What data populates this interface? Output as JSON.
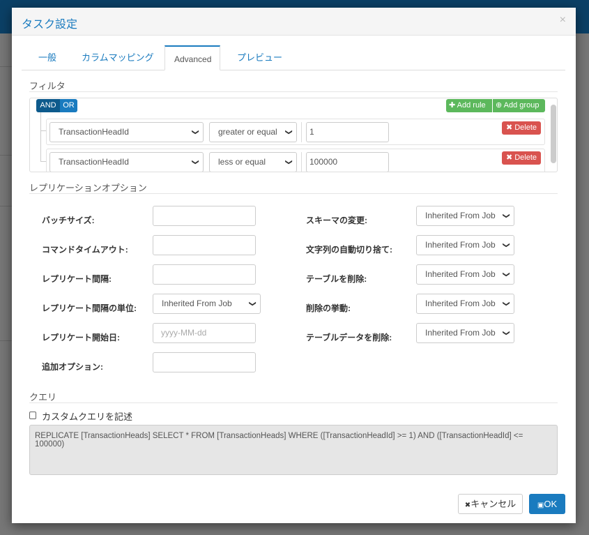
{
  "modal": {
    "title": "タスク設定",
    "close": "×"
  },
  "tabs": [
    {
      "label": "一般"
    },
    {
      "label": "カラムマッピング"
    },
    {
      "label": "Advanced"
    },
    {
      "label": "プレビュー"
    }
  ],
  "filter": {
    "section_title": "フィルタ",
    "and_label": "AND",
    "or_label": "OR",
    "add_rule": "Add rule",
    "add_group": "Add group",
    "rules": [
      {
        "field": "TransactionHeadId",
        "operator": "greater or equal",
        "value": "1",
        "delete": "Delete"
      },
      {
        "field": "TransactionHeadId",
        "operator": "less or equal",
        "value": "100000",
        "delete": "Delete"
      }
    ]
  },
  "replication": {
    "section_title": "レプリケーションオプション",
    "left": [
      {
        "label": "バッチサイズ:",
        "value": "",
        "placeholder": ""
      },
      {
        "label": "コマンドタイムアウト:",
        "value": "",
        "placeholder": ""
      },
      {
        "label": "レプリケート間隔:",
        "value": "",
        "placeholder": ""
      },
      {
        "label": "レプリケート間隔の単位:",
        "value": "Inherited From Job"
      },
      {
        "label": "レプリケート開始日:",
        "value": "",
        "placeholder": "yyyy-MM-dd"
      },
      {
        "label": "追加オプション:",
        "value": "",
        "placeholder": ""
      }
    ],
    "right": [
      {
        "label": "スキーマの変更:",
        "value": "Inherited From Job"
      },
      {
        "label": "文字列の自動切り捨て:",
        "value": "Inherited From Job"
      },
      {
        "label": "テーブルを削除:",
        "value": "Inherited From Job"
      },
      {
        "label": "削除の挙動:",
        "value": "Inherited From Job"
      },
      {
        "label": "テーブルデータを削除:",
        "value": "Inherited From Job"
      }
    ]
  },
  "query": {
    "section_title": "クエリ",
    "custom_label": "カスタムクエリを記述",
    "custom_checked": false,
    "text": "REPLICATE [TransactionHeads] SELECT * FROM [TransactionHeads] WHERE ([TransactionHeadId] >= 1) AND ([TransactionHeadId] <= 100000)"
  },
  "footer": {
    "cancel": "キャンセル",
    "ok": "OK"
  },
  "colors": {
    "accent": "#1a7bbf",
    "success": "#5cb85c",
    "danger": "#d9534f"
  }
}
